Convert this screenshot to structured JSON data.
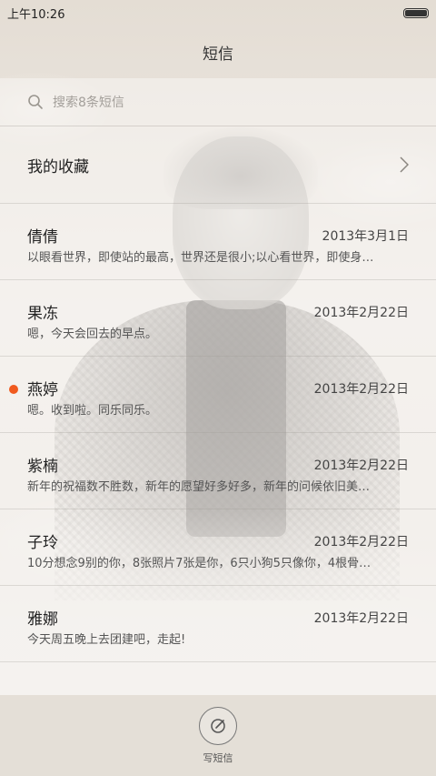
{
  "status_bar": {
    "time": "上午10:26"
  },
  "header": {
    "title": "短信"
  },
  "search": {
    "placeholder": "搜索8条短信"
  },
  "favorites": {
    "label": "我的收藏"
  },
  "messages": [
    {
      "name": "倩倩",
      "date": "2013年3月1日",
      "preview": "以眼看世界，即使站的最高，世界还是很小;以心看世界，即使身…",
      "unread": false
    },
    {
      "name": "果冻",
      "date": "2013年2月22日",
      "preview": "嗯，今天会回去的早点。",
      "unread": false
    },
    {
      "name": "燕婷",
      "date": "2013年2月22日",
      "preview": "嗯。收到啦。同乐同乐。",
      "unread": true
    },
    {
      "name": "紫楠",
      "date": "2013年2月22日",
      "preview": "新年的祝福数不胜数，新年的愿望好多好多，新年的问候依旧美…",
      "unread": false
    },
    {
      "name": "子玲",
      "date": "2013年2月22日",
      "preview": "10分想念9别的你，8张照片7张是你，6只小狗5只像你，4根骨…",
      "unread": false
    },
    {
      "name": "雅娜",
      "date": "2013年2月22日",
      "preview": "今天周五晚上去团建吧，走起!",
      "unread": false
    }
  ],
  "bottom": {
    "compose_label": "写短信"
  },
  "colors": {
    "unread_dot": "#f05a1e",
    "background": "#ece8e2"
  }
}
